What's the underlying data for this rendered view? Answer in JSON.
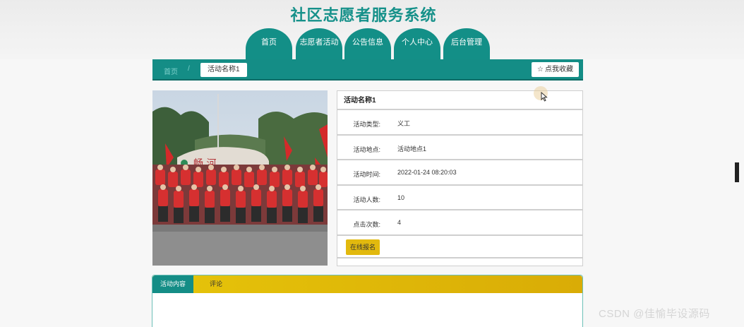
{
  "header": {
    "site_title": "社区志愿者服务系统",
    "nav": [
      {
        "label": "首页"
      },
      {
        "label": "志愿者活动"
      },
      {
        "label": "公告信息"
      },
      {
        "label": "个人中心"
      },
      {
        "label": "后台管理"
      }
    ]
  },
  "breadcrumb": {
    "home": "首页",
    "separator": "/",
    "current": "活动名称1",
    "favorite_label": "点我收藏"
  },
  "detail": {
    "title": "活动名称1",
    "rows": [
      {
        "label": "活动类型:",
        "value": "义工"
      },
      {
        "label": "活动地点:",
        "value": "活动地点1"
      },
      {
        "label": "活动时间:",
        "value": "2022-01-24 08:20:03"
      },
      {
        "label": "活动人数:",
        "value": "10"
      },
      {
        "label": "点击次数:",
        "value": "4"
      }
    ],
    "signup_label": "在线报名"
  },
  "tabs": {
    "items": [
      {
        "label": "活动内容"
      },
      {
        "label": "评论"
      }
    ]
  },
  "watermark": "CSDN @佳愉毕设源码",
  "colors": {
    "primary": "#148d86",
    "accent": "#e2b90e"
  },
  "icons": {
    "favorite": "star-outline-icon"
  }
}
